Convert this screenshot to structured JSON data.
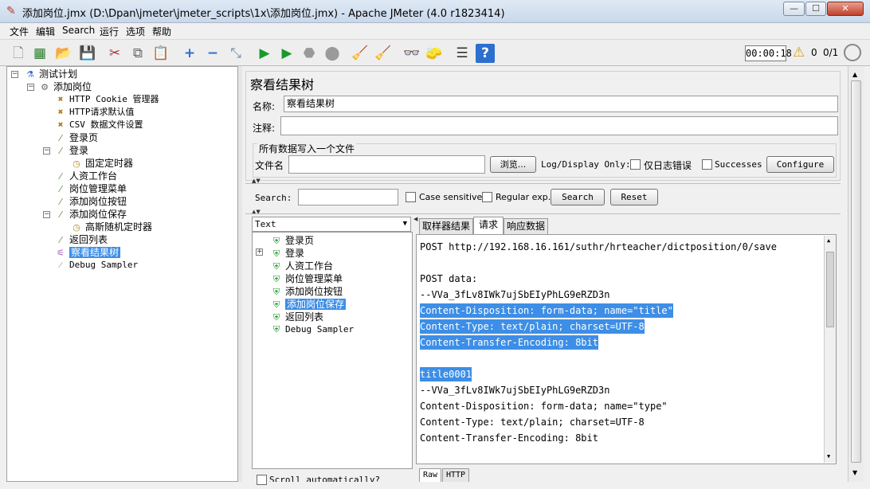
{
  "window": {
    "title": "添加岗位.jmx (D:\\Dpan\\jmeter\\jmeter_scripts\\1x\\添加岗位.jmx) - Apache JMeter (4.0 r1823414)",
    "minimize": "—",
    "maximize": "☐",
    "close": "✕"
  },
  "menu": [
    "文件",
    "编辑",
    "Search",
    "运行",
    "选项",
    "帮助"
  ],
  "toolbar": {
    "timer": "00:00:18",
    "warning_count": "0",
    "threads": "0/1"
  },
  "tree": {
    "items": [
      {
        "label": "测试计划",
        "icon": "flask-icon"
      },
      {
        "label": "添加岗位",
        "icon": "gear-icon"
      },
      {
        "label": "HTTP Cookie 管理器",
        "icon": "tools-icon"
      },
      {
        "label": "HTTP请求默认值",
        "icon": "tools-icon"
      },
      {
        "label": "CSV 数据文件设置",
        "icon": "tools-icon"
      },
      {
        "label": "登录页",
        "icon": "pipette-icon"
      },
      {
        "label": "登录",
        "icon": "pipette-icon"
      },
      {
        "label": "固定定时器",
        "icon": "clock-icon"
      },
      {
        "label": "人资工作台",
        "icon": "pipette-icon"
      },
      {
        "label": "岗位管理菜单",
        "icon": "pipette-icon"
      },
      {
        "label": "添加岗位按钮",
        "icon": "pipette-icon"
      },
      {
        "label": "添加岗位保存",
        "icon": "pipette-icon"
      },
      {
        "label": "高斯随机定时器",
        "icon": "clock-icon"
      },
      {
        "label": "返回列表",
        "icon": "pipette-icon"
      },
      {
        "label": "察看结果树",
        "icon": "chart-icon"
      },
      {
        "label": "Debug Sampler",
        "icon": "pipette-icon"
      }
    ]
  },
  "panel": {
    "title": "察看结果树",
    "name_label": "名称:",
    "name_value": "察看结果树",
    "comment_label": "注释:",
    "comment_value": "",
    "file_group_label": "所有数据写入一个文件",
    "filename_label": "文件名",
    "filename_value": "",
    "browse_button": "浏览...",
    "log_display_label": "Log/Display Only:",
    "errors_only_label": "仅日志错误",
    "successes_label": "Successes",
    "configure_button": "Configure",
    "search_label": "Search:",
    "search_value": "",
    "case_sensitive_label": "Case sensitive",
    "regular_exp_label": "Regular exp.",
    "search_button": "Search",
    "reset_button": "Reset"
  },
  "renderer": {
    "selected": "Text"
  },
  "results_tree": {
    "items": [
      {
        "label": "登录页",
        "status": "success"
      },
      {
        "label": "登录",
        "status": "success",
        "expandable": true
      },
      {
        "label": "人资工作台",
        "status": "success"
      },
      {
        "label": "岗位管理菜单",
        "status": "success"
      },
      {
        "label": "添加岗位按钮",
        "status": "success"
      },
      {
        "label": "添加岗位保存",
        "status": "success",
        "selected": true
      },
      {
        "label": "返回列表",
        "status": "success"
      },
      {
        "label": "Debug Sampler",
        "status": "success"
      }
    ],
    "scroll_auto_label": "Scroll automatically?"
  },
  "result_tabs": [
    "取样器结果",
    "请求",
    "响应数据"
  ],
  "request": {
    "lines": [
      {
        "text": "POST http://192.168.16.161/suthr/hrteacher/dictposition/0/save",
        "hl": false
      },
      {
        "text": "",
        "hl": false
      },
      {
        "text": "POST data:",
        "hl": false
      },
      {
        "text": "--VVa_3fLv8IWk7ujSbEIyPhLG9eRZD3n",
        "hl": false
      },
      {
        "text": "Content-Disposition: form-data; name=\"title\"",
        "hl": true
      },
      {
        "text": "Content-Type: text/plain; charset=UTF-8",
        "hl": true
      },
      {
        "text": "Content-Transfer-Encoding: 8bit",
        "hl": true
      },
      {
        "text": "",
        "hl": false
      },
      {
        "text": "title0001",
        "hl": true
      },
      {
        "text": "--VVa_3fLv8IWk7ujSbEIyPhLG9eRZD3n",
        "hl": false
      },
      {
        "text": "Content-Disposition: form-data; name=\"type\"",
        "hl": false
      },
      {
        "text": "Content-Type: text/plain; charset=UTF-8",
        "hl": false
      },
      {
        "text": "Content-Transfer-Encoding: 8bit",
        "hl": false
      }
    ],
    "subtabs": [
      "Raw",
      "HTTP"
    ]
  }
}
